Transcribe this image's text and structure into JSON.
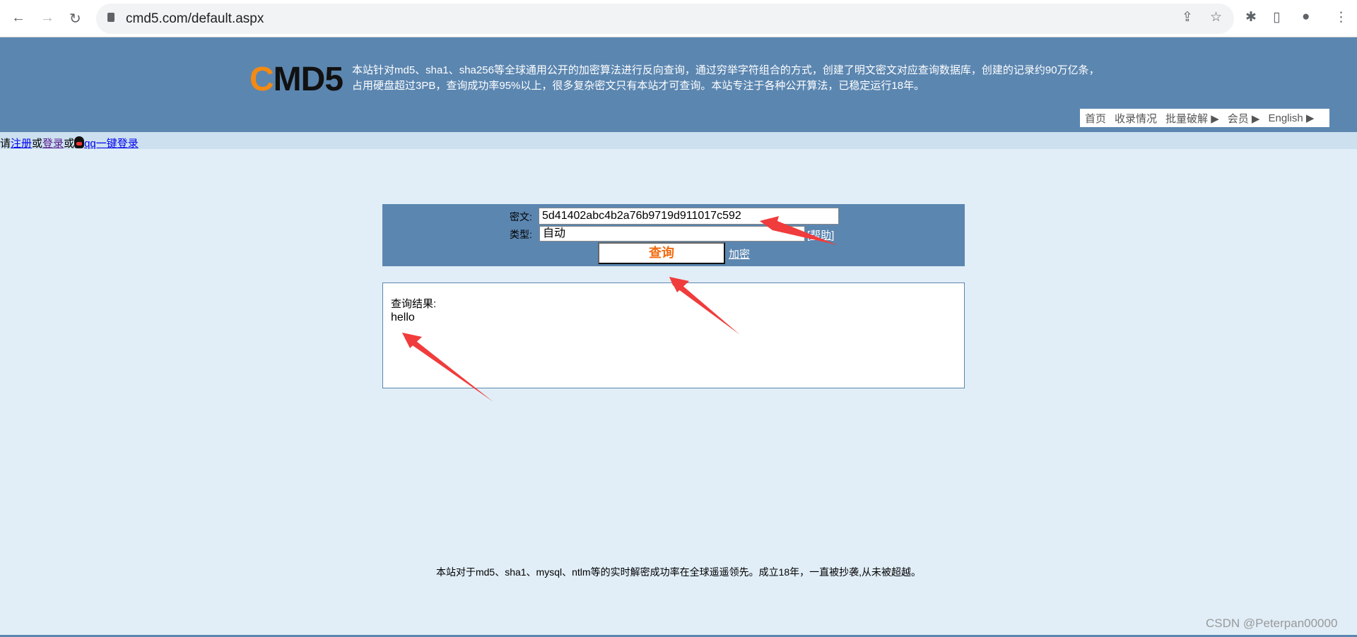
{
  "browser": {
    "url": "cmd5.com/default.aspx"
  },
  "header": {
    "logo": "CMD5",
    "desc_line1": "本站针对md5、sha1、sha256等全球通用公开的加密算法进行反向查询，通过穷举字符组合的方式，创建了明文密文对应查询数据库，创建的记录约90万亿条，",
    "desc_line2": "占用硬盘超过3PB，查询成功率95%以上，很多复杂密文只有本站才可查询。本站专注于各种公开算法，已稳定运行18年。",
    "nav": [
      "首页",
      "收录情况",
      "批量破解 ▶",
      "会员 ▶",
      "English ▶"
    ]
  },
  "login": {
    "prefix": "请",
    "register": "注册",
    "or1": "或",
    "login": "登录",
    "or2": "或",
    "qq": "qq一键登录"
  },
  "form": {
    "cipher_label": "密文:",
    "cipher_value": "5d41402abc4b2a76b9719d911017c592",
    "type_label": "类型:",
    "type_value": "自动",
    "help": "[帮助]",
    "query_button": "查询",
    "encrypt": "加密"
  },
  "result": {
    "label": "查询结果:",
    "value": "hello"
  },
  "footer": "本站对于md5、sha1、mysql、ntlm等的实时解密成功率在全球遥遥领先。成立18年，一直被抄袭,从未被超越。",
  "watermark": "CSDN @Peterpan00000",
  "colors": {
    "header": "#5b86b0",
    "accent": "#f26b10",
    "annotation": "#f03c3c"
  }
}
